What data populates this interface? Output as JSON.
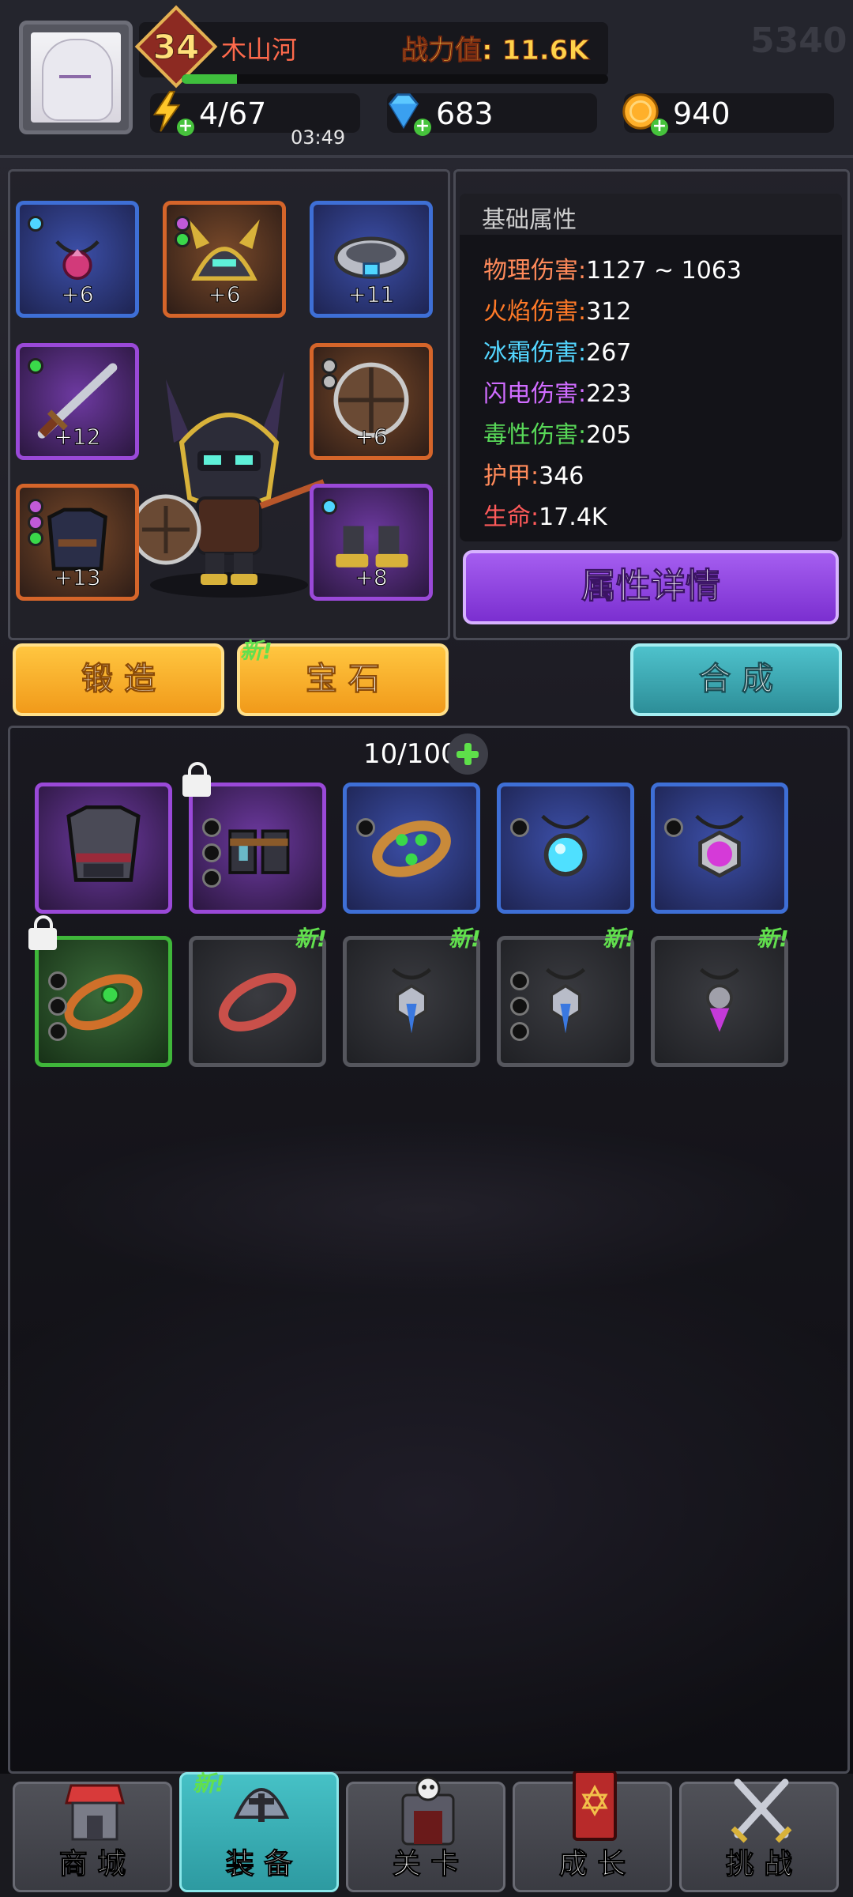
{
  "header": {
    "level": "34",
    "player_name": "木山河",
    "power_label": "战力值: 11.6K",
    "uid_watermark": "5340",
    "exp_progress": 0.13,
    "energy": "4/67",
    "energy_timer": "03:49",
    "gems": "683",
    "coins": "940"
  },
  "equipment": {
    "slots": [
      {
        "id": "necklace",
        "level": "+6",
        "rarity": "blue"
      },
      {
        "id": "helmet",
        "level": "+6",
        "rarity": "orange"
      },
      {
        "id": "bracer",
        "level": "+11",
        "rarity": "blue"
      },
      {
        "id": "sword",
        "level": "+12",
        "rarity": "purple"
      },
      {
        "id": "shield",
        "level": "+6",
        "rarity": "orange"
      },
      {
        "id": "armor",
        "level": "+13",
        "rarity": "orange"
      },
      {
        "id": "boots",
        "level": "+8",
        "rarity": "purple"
      }
    ]
  },
  "attributes": {
    "title": "基础属性",
    "rows": [
      {
        "label": "物理伤害:",
        "value": "1127 ~ 1063",
        "color": "#ff8a5a"
      },
      {
        "label": "火焰伤害:",
        "value": "312",
        "color": "#ff7a28"
      },
      {
        "label": "冰霜伤害:",
        "value": "267",
        "color": "#53d6ff"
      },
      {
        "label": "闪电伤害:",
        "value": "223",
        "color": "#d06cff"
      },
      {
        "label": "毒性伤害:",
        "value": "205",
        "color": "#58d858"
      },
      {
        "label": "护甲:",
        "value": "346",
        "color": "#ff8a5a"
      },
      {
        "label": "生命:",
        "value": "17.4K",
        "color": "#ff5a5a"
      }
    ],
    "details_button": "属性详情"
  },
  "actions": {
    "forge": "锻 造",
    "gem": "宝 石",
    "gem_new": "新!",
    "synthesize": "合 成"
  },
  "inventory": {
    "capacity": "10/100",
    "new_label": "新!",
    "items": [
      {
        "id": "chest-armor",
        "rarity": "purple",
        "locked": false,
        "holes": 0,
        "is_new": false
      },
      {
        "id": "leg-armor",
        "rarity": "purple",
        "locked": true,
        "holes": 3,
        "is_new": false
      },
      {
        "id": "ring-gold",
        "rarity": "blue",
        "locked": false,
        "holes": 1,
        "is_new": false
      },
      {
        "id": "amulet-blue",
        "rarity": "blue",
        "locked": false,
        "holes": 1,
        "is_new": false
      },
      {
        "id": "amulet-purple",
        "rarity": "blue",
        "locked": false,
        "holes": 1,
        "is_new": false
      },
      {
        "id": "ring-green",
        "rarity": "green",
        "locked": true,
        "holes": 3,
        "is_new": false
      },
      {
        "id": "bangle-red",
        "rarity": "gray",
        "locked": false,
        "holes": 0,
        "is_new": true
      },
      {
        "id": "pendant-blue-a",
        "rarity": "gray",
        "locked": false,
        "holes": 0,
        "is_new": true
      },
      {
        "id": "pendant-blue-b",
        "rarity": "gray",
        "locked": false,
        "holes": 3,
        "is_new": true
      },
      {
        "id": "pendant-purple",
        "rarity": "gray",
        "locked": false,
        "holes": 0,
        "is_new": true
      }
    ]
  },
  "nav": {
    "items": [
      {
        "label": "商 城",
        "icon": "shop-icon"
      },
      {
        "label": "装 备",
        "icon": "helmet-icon",
        "active": true,
        "new": "新!"
      },
      {
        "label": "关 卡",
        "icon": "skull-gate-icon"
      },
      {
        "label": "成 长",
        "icon": "book-icon"
      },
      {
        "label": "挑 战",
        "icon": "crossed-swords-icon"
      }
    ]
  }
}
